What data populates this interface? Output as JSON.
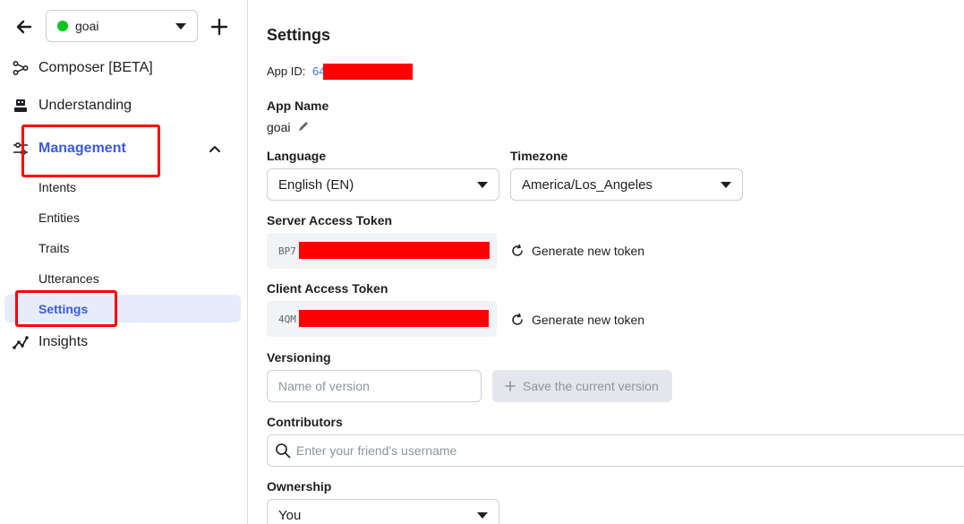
{
  "sidebar": {
    "app_name": "goai",
    "nav": [
      {
        "label": "Composer [BETA]"
      },
      {
        "label": "Understanding"
      },
      {
        "label": "Management"
      },
      {
        "label": "Insights"
      }
    ],
    "sub_items": [
      "Intents",
      "Entities",
      "Traits",
      "Utterances",
      "Settings"
    ]
  },
  "main": {
    "title": "Settings",
    "app_id_label": "App ID:",
    "app_id_prefix": "64",
    "app_name_label": "App Name",
    "app_name_value": "goai",
    "language_label": "Language",
    "language_value": "English (EN)",
    "timezone_label": "Timezone",
    "timezone_value": "America/Los_Angeles",
    "server_token_label": "Server Access Token",
    "server_token_prefix": "BP7",
    "client_token_label": "Client Access Token",
    "client_token_prefix": "4QM",
    "generate_label": "Generate new token",
    "versioning_label": "Versioning",
    "version_placeholder": "Name of version",
    "save_version_label": "Save the current version",
    "contributors_label": "Contributors",
    "contributors_placeholder": "Enter your friend's username",
    "ownership_label": "Ownership",
    "ownership_value": "You"
  },
  "colors": {
    "accent": "#3b5bdb",
    "status_online": "#00c61c",
    "highlight_box": "#ff0000",
    "redaction": "#ff0000"
  }
}
